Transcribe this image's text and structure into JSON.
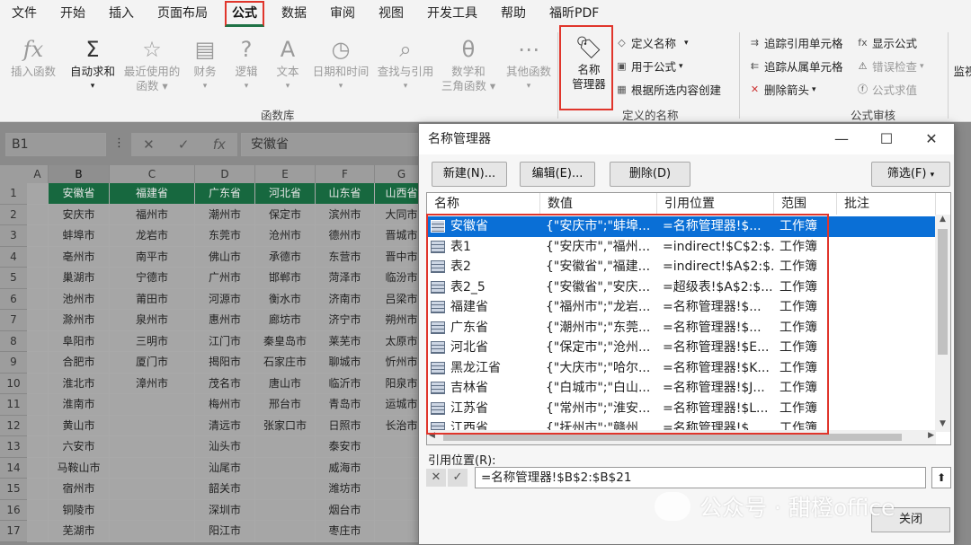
{
  "menu": [
    "文件",
    "开始",
    "插入",
    "页面布局",
    "公式",
    "数据",
    "审阅",
    "视图",
    "开发工具",
    "帮助",
    "福昕PDF"
  ],
  "ribbon": {
    "insert_function": "插入函数",
    "autosum": "自动求和",
    "recent_1": "最近使用的",
    "recent_2": "函数",
    "finance": "财务",
    "logic": "逻辑",
    "text": "文本",
    "datetime": "日期和时间",
    "lookup": "查找与引用",
    "math_1": "数学和",
    "math_2": "三角函数",
    "other": "其他函数",
    "group_library": "函数库",
    "name_mgr_1": "名称",
    "name_mgr_2": "管理器",
    "define_name": "定义名称",
    "use_in_formula": "用于公式",
    "create_from_sel": "根据所选内容创建",
    "group_defined": "定义的名称",
    "trace_prec": "追踪引用单元格",
    "trace_dep": "追踪从属单元格",
    "remove_arrows": "删除箭头",
    "show_formulas": "显示公式",
    "error_check": "错误检查",
    "eval_formula": "公式求值",
    "group_audit": "公式审核",
    "watch": "监视"
  },
  "formula_bar": {
    "name_box": "B1",
    "content": "安徽省"
  },
  "columns": [
    "A",
    "B",
    "C",
    "D",
    "E",
    "F",
    "G"
  ],
  "rows": [
    "1",
    "2",
    "3",
    "4",
    "5",
    "6",
    "7",
    "8",
    "9",
    "10",
    "11",
    "12",
    "13",
    "14",
    "15",
    "16",
    "17"
  ],
  "sheet": {
    "headers": [
      "安徽省",
      "福建省",
      "广东省",
      "河北省",
      "山东省",
      "山西省"
    ],
    "data": [
      [
        "安庆市",
        "福州市",
        "潮州市",
        "保定市",
        "滨州市",
        "大同市"
      ],
      [
        "蚌埠市",
        "龙岩市",
        "东莞市",
        "沧州市",
        "德州市",
        "晋城市"
      ],
      [
        "亳州市",
        "南平市",
        "佛山市",
        "承德市",
        "东营市",
        "晋中市"
      ],
      [
        "巢湖市",
        "宁德市",
        "广州市",
        "邯郸市",
        "菏泽市",
        "临汾市"
      ],
      [
        "池州市",
        "莆田市",
        "河源市",
        "衡水市",
        "济南市",
        "吕梁市"
      ],
      [
        "滁州市",
        "泉州市",
        "惠州市",
        "廊坊市",
        "济宁市",
        "朔州市"
      ],
      [
        "阜阳市",
        "三明市",
        "江门市",
        "秦皇岛市",
        "莱芜市",
        "太原市"
      ],
      [
        "合肥市",
        "厦门市",
        "揭阳市",
        "石家庄市",
        "聊城市",
        "忻州市"
      ],
      [
        "淮北市",
        "漳州市",
        "茂名市",
        "唐山市",
        "临沂市",
        "阳泉市"
      ],
      [
        "淮南市",
        "",
        "梅州市",
        "邢台市",
        "青岛市",
        "运城市"
      ],
      [
        "黄山市",
        "",
        "清远市",
        "张家口市",
        "日照市",
        "长治市"
      ],
      [
        "六安市",
        "",
        "汕头市",
        "",
        "泰安市",
        ""
      ],
      [
        "马鞍山市",
        "",
        "汕尾市",
        "",
        "威海市",
        ""
      ],
      [
        "宿州市",
        "",
        "韶关市",
        "",
        "潍坊市",
        ""
      ],
      [
        "铜陵市",
        "",
        "深圳市",
        "",
        "烟台市",
        ""
      ],
      [
        "芜湖市",
        "",
        "阳江市",
        "",
        "枣庄市",
        ""
      ]
    ]
  },
  "dialog": {
    "title": "名称管理器",
    "btn_new": "新建(N)...",
    "btn_edit": "编辑(E)...",
    "btn_delete": "删除(D)",
    "btn_filter": "筛选(F)",
    "col_name": "名称",
    "col_value": "数值",
    "col_ref": "引用位置",
    "col_scope": "范围",
    "col_comment": "批注",
    "rows": [
      [
        "安徽省",
        "{\"安庆市\";\"蚌埠...",
        "=名称管理器!$...",
        "工作簿"
      ],
      [
        "表1",
        "{\"安庆市\",\"福州...",
        "=indirect!$C$2:$...",
        "工作簿"
      ],
      [
        "表2",
        "{\"安徽省\",\"福建...",
        "=indirect!$A$2:$...",
        "工作簿"
      ],
      [
        "表2_5",
        "{\"安徽省\",\"安庆...",
        "=超级表!$A$2:$...",
        "工作簿"
      ],
      [
        "福建省",
        "{\"福州市\";\"龙岩...",
        "=名称管理器!$...",
        "工作簿"
      ],
      [
        "广东省",
        "{\"潮州市\";\"东莞...",
        "=名称管理器!$...",
        "工作簿"
      ],
      [
        "河北省",
        "{\"保定市\";\"沧州...",
        "=名称管理器!$E...",
        "工作簿"
      ],
      [
        "黑龙江省",
        "{\"大庆市\";\"哈尔...",
        "=名称管理器!$K...",
        "工作簿"
      ],
      [
        "吉林省",
        "{\"白城市\";\"白山...",
        "=名称管理器!$J...",
        "工作簿"
      ],
      [
        "江苏省",
        "{\"常州市\";\"淮安...",
        "=名称管理器!$L...",
        "工作簿"
      ],
      [
        "江西省",
        "{\"抚州市\";\"赣州...",
        "=名称管理器!$...",
        "工作簿"
      ]
    ],
    "ref_label": "引用位置(R):",
    "ref_value": "=名称管理器!$B$2:$B$21",
    "btn_close": "关闭"
  },
  "watermark": "公众号 · 甜橙office"
}
